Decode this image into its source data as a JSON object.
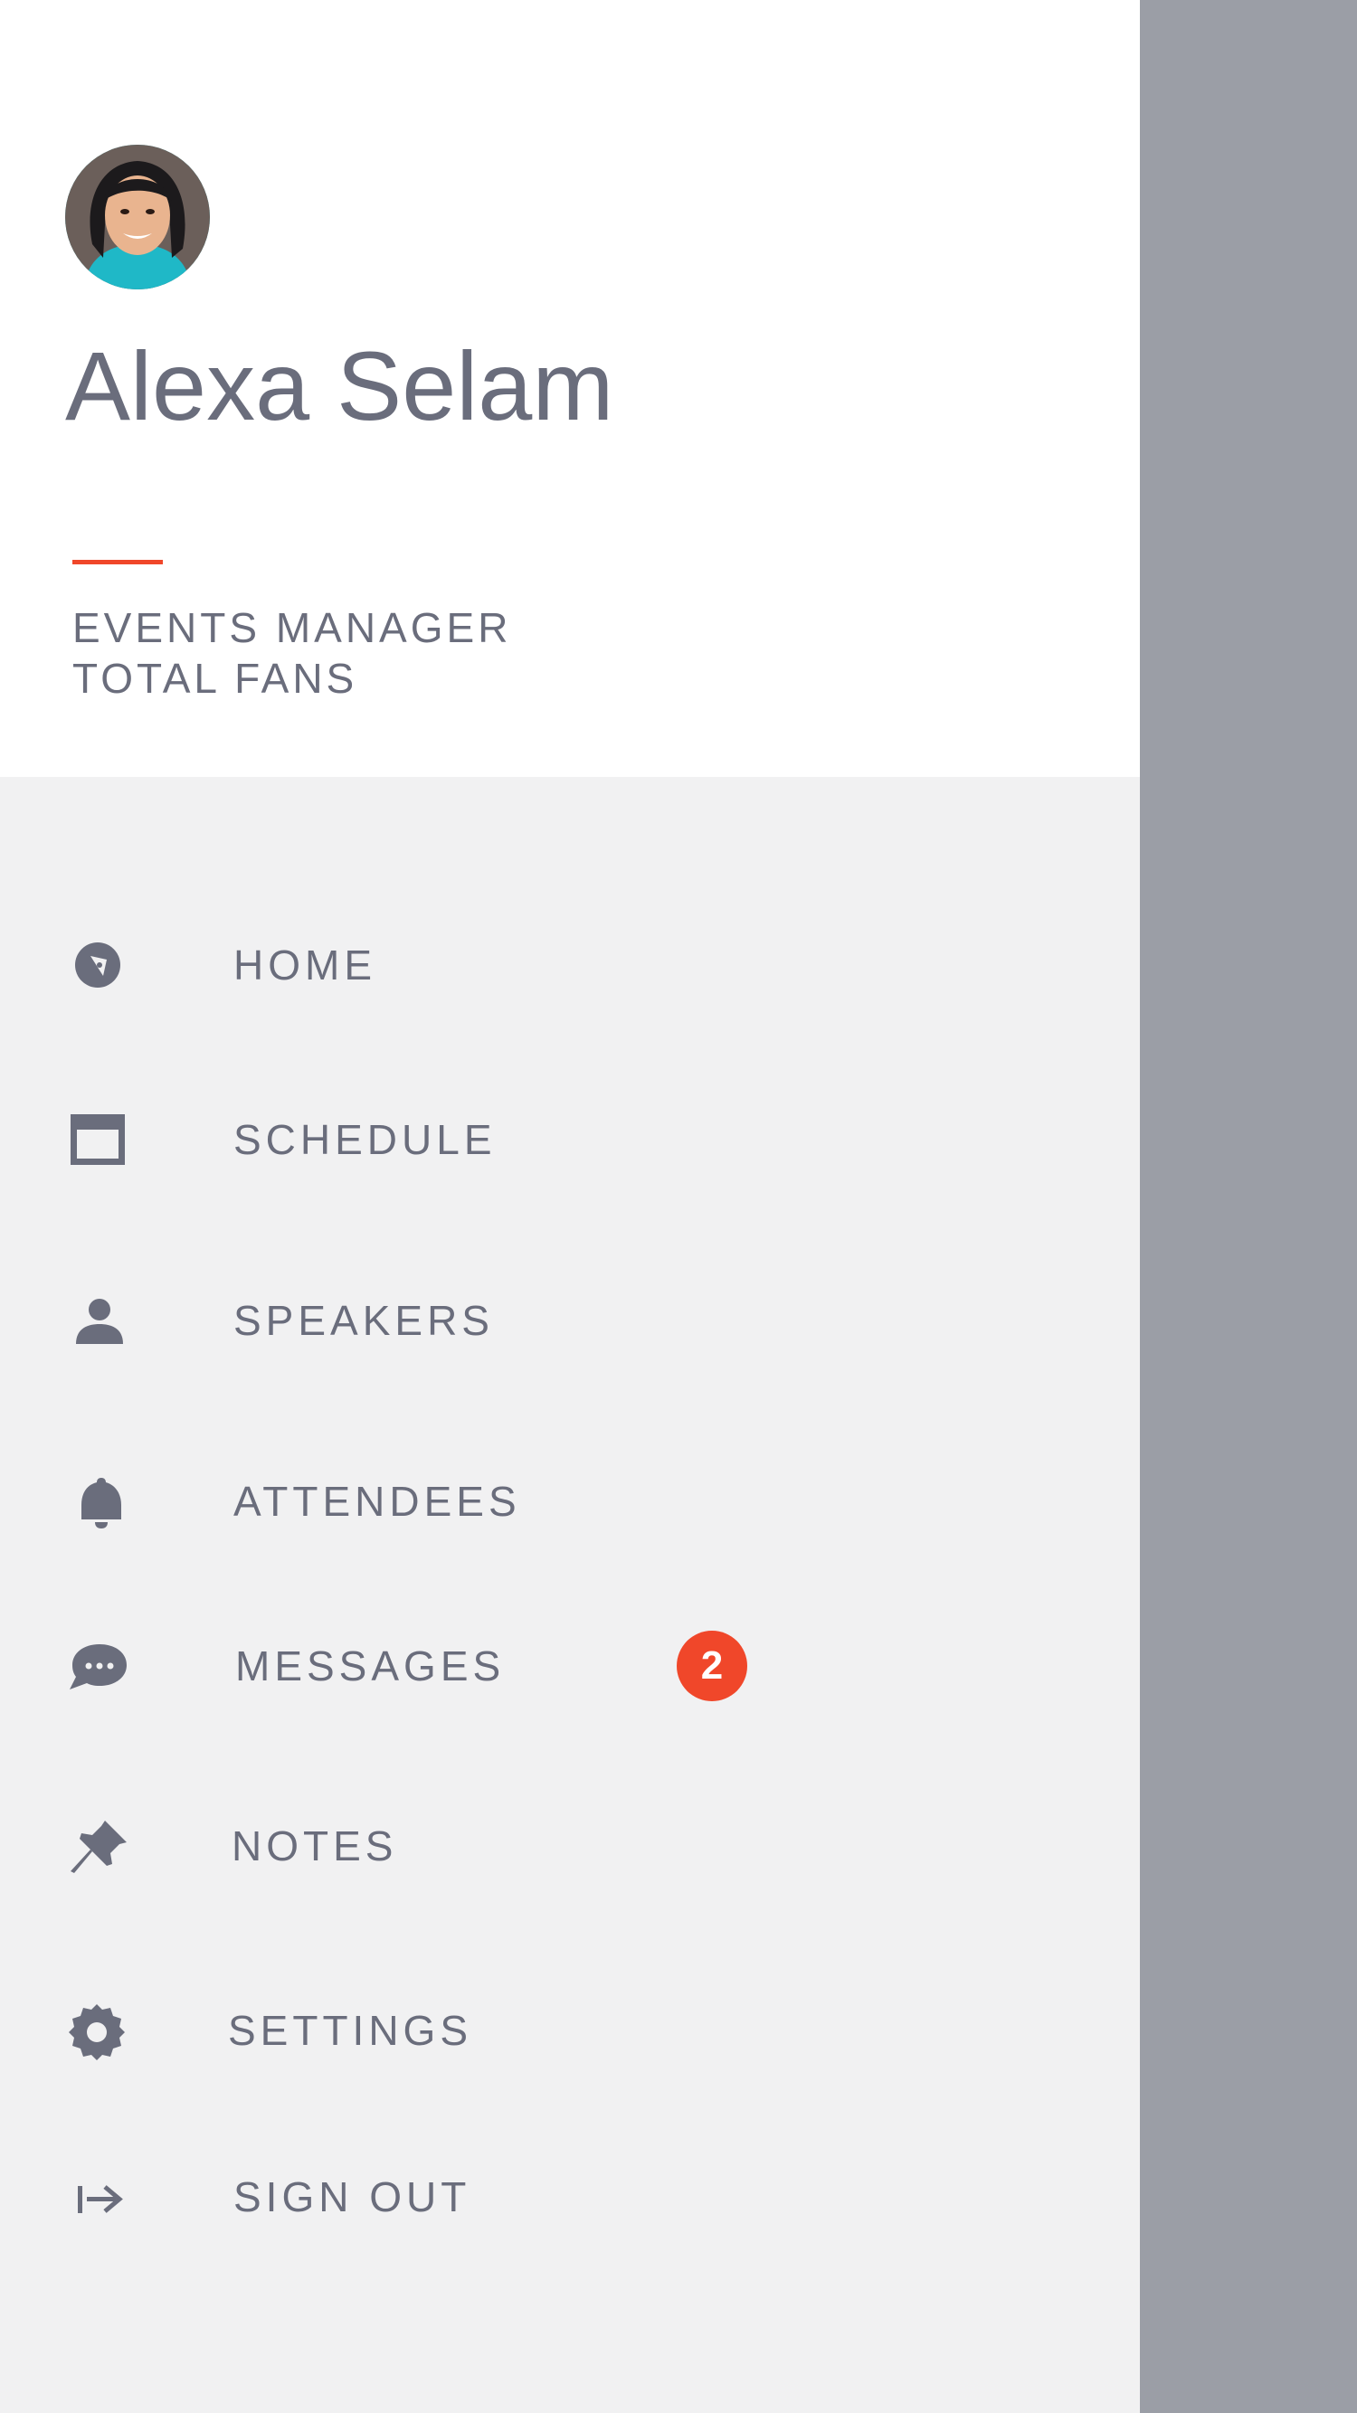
{
  "profile": {
    "name": "Alexa Selam",
    "role": "EVENTS MANAGER",
    "fans": "TOTAL FANS"
  },
  "colors": {
    "accent": "#f0472a",
    "text": "#6a6d7c",
    "drawer_bg": "#f1f1f2",
    "header_bg": "#ffffff",
    "scrim": "#9b9ea6"
  },
  "nav": {
    "items": [
      {
        "label": "HOME",
        "icon": "compass-icon"
      },
      {
        "label": "SCHEDULE",
        "icon": "calendar-icon"
      },
      {
        "label": "SPEAKERS",
        "icon": "person-icon"
      },
      {
        "label": "ATTENDEES",
        "icon": "bell-icon"
      },
      {
        "label": "MESSAGES",
        "icon": "chat-icon",
        "badge": "2"
      },
      {
        "label": "NOTES",
        "icon": "pin-icon"
      },
      {
        "label": "SETTINGS",
        "icon": "gear-icon"
      },
      {
        "label": "SIGN OUT",
        "icon": "sign-out-icon"
      }
    ]
  }
}
